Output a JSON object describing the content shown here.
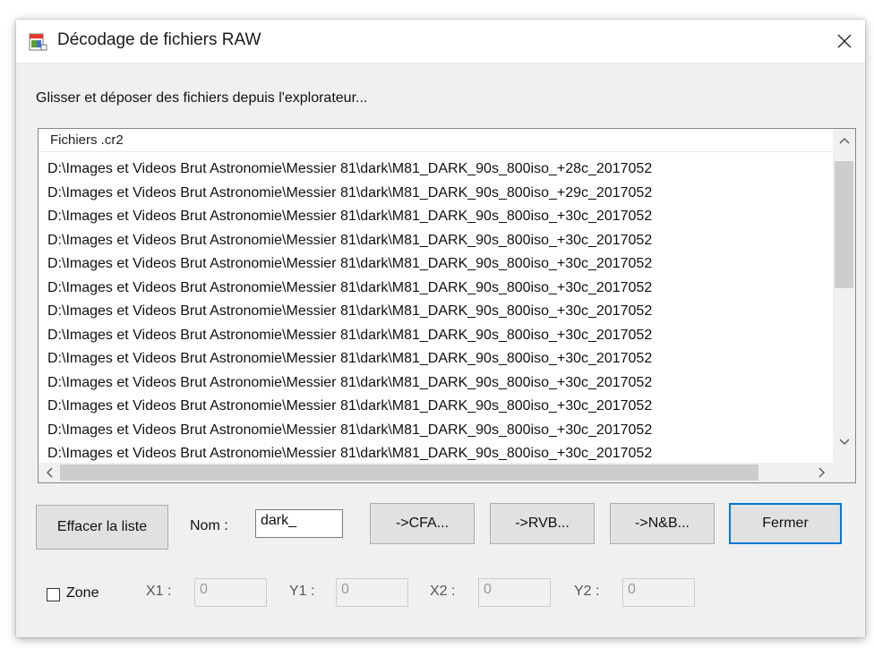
{
  "window": {
    "title": "Décodage de fichiers RAW",
    "close_glyph": "✕"
  },
  "instruction": "Glisser et déposer des fichiers depuis l'explorateur...",
  "list": {
    "header": "Fichiers .cr2",
    "items": [
      "D:\\Images et Videos Brut Astronomie\\Messier 81\\dark\\M81_DARK_90s_800iso_+28c_2017052",
      "D:\\Images et Videos Brut Astronomie\\Messier 81\\dark\\M81_DARK_90s_800iso_+29c_2017052",
      "D:\\Images et Videos Brut Astronomie\\Messier 81\\dark\\M81_DARK_90s_800iso_+30c_2017052",
      "D:\\Images et Videos Brut Astronomie\\Messier 81\\dark\\M81_DARK_90s_800iso_+30c_2017052",
      "D:\\Images et Videos Brut Astronomie\\Messier 81\\dark\\M81_DARK_90s_800iso_+30c_2017052",
      "D:\\Images et Videos Brut Astronomie\\Messier 81\\dark\\M81_DARK_90s_800iso_+30c_2017052",
      "D:\\Images et Videos Brut Astronomie\\Messier 81\\dark\\M81_DARK_90s_800iso_+30c_2017052",
      "D:\\Images et Videos Brut Astronomie\\Messier 81\\dark\\M81_DARK_90s_800iso_+30c_2017052",
      "D:\\Images et Videos Brut Astronomie\\Messier 81\\dark\\M81_DARK_90s_800iso_+30c_2017052",
      "D:\\Images et Videos Brut Astronomie\\Messier 81\\dark\\M81_DARK_90s_800iso_+30c_2017052",
      "D:\\Images et Videos Brut Astronomie\\Messier 81\\dark\\M81_DARK_90s_800iso_+30c_2017052",
      "D:\\Images et Videos Brut Astronomie\\Messier 81\\dark\\M81_DARK_90s_800iso_+30c_2017052",
      "D:\\Images et Videos Brut Astronomie\\Messier 81\\dark\\M81_DARK_90s_800iso_+30c_2017052"
    ]
  },
  "buttons": {
    "clear": "Effacer la liste",
    "cfa": "->CFA...",
    "rvb": "->RVB...",
    "nb": "->N&B...",
    "close": "Fermer"
  },
  "name_field": {
    "label": "Nom :",
    "value": "dark_"
  },
  "zone": {
    "checkbox_label": "Zone",
    "checked": false,
    "x1_label": "X1 :",
    "x1_value": "0",
    "y1_label": "Y1 :",
    "y1_value": "0",
    "x2_label": "X2 :",
    "x2_value": "0",
    "y2_label": "Y2 :",
    "y2_value": "0"
  },
  "icons": {
    "app": "raw-file-app-icon",
    "close": "close-icon",
    "scroll_up": "chevron-up-icon",
    "scroll_down": "chevron-down-icon",
    "scroll_left": "chevron-left-icon",
    "scroll_right": "chevron-right-icon"
  }
}
